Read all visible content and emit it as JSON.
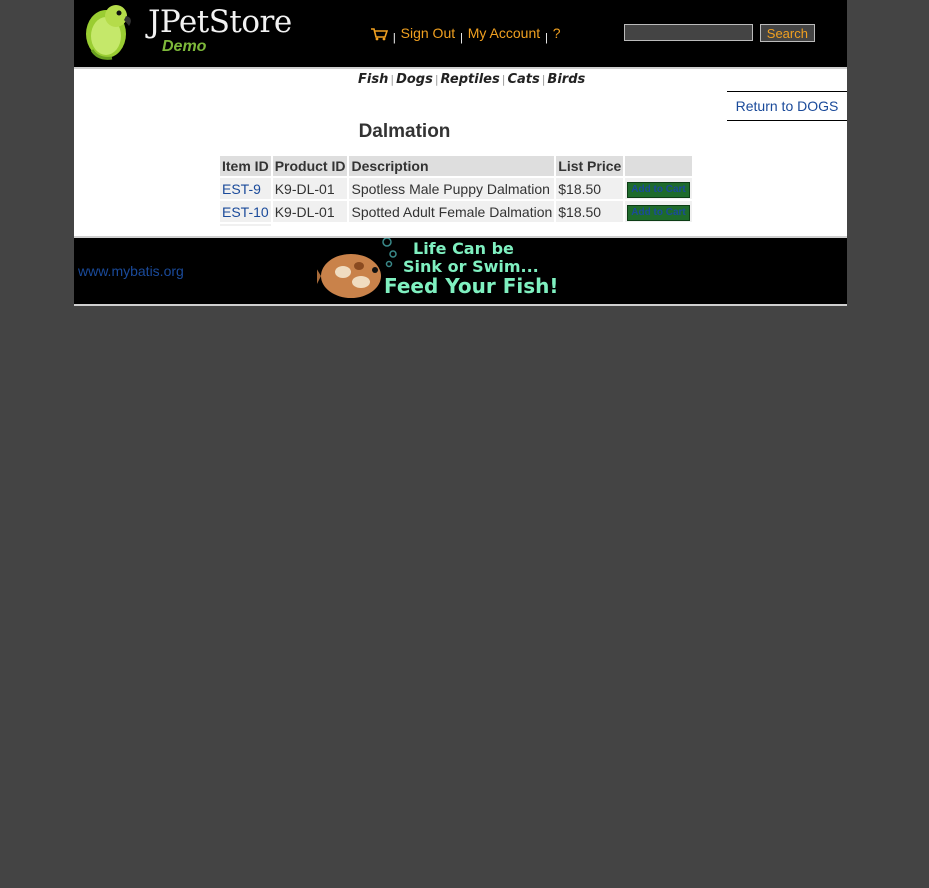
{
  "header": {
    "logo_title": "JPetStore",
    "logo_subtitle": "Demo",
    "menu": {
      "cart_icon": "cart-icon",
      "sep": "|",
      "sign_out": "Sign Out",
      "my_account": "My Account",
      "help": "?"
    },
    "search": {
      "value": "",
      "button_label": "Search"
    }
  },
  "quicklinks": {
    "items": [
      "Fish",
      "Dogs",
      "Reptiles",
      "Cats",
      "Birds"
    ],
    "sep": "|"
  },
  "back_link": "Return to DOGS",
  "page_title": "Dalmation",
  "table": {
    "headers": [
      "Item ID",
      "Product ID",
      "Description",
      "List Price",
      ""
    ],
    "rows": [
      {
        "item_id": "EST-9",
        "product_id": "K9-DL-01",
        "description": "Spotless Male Puppy Dalmation",
        "price": "$18.50",
        "action": "Add to Cart"
      },
      {
        "item_id": "EST-10",
        "product_id": "K9-DL-01",
        "description": "Spotted Adult Female Dalmation",
        "price": "$18.50",
        "action": "Add to Cart"
      }
    ]
  },
  "footer": {
    "link": "www.mybatis.org",
    "banner_lines": [
      "Life Can be",
      "Sink or Swim...",
      "Feed Your Fish!"
    ]
  },
  "colors": {
    "background": "#444444",
    "header_bg": "#000000",
    "menu_link": "#f0a020",
    "link": "#1a4a9a",
    "add_to_cart": "#1e6b2c",
    "logo_green": "#7db83a"
  }
}
